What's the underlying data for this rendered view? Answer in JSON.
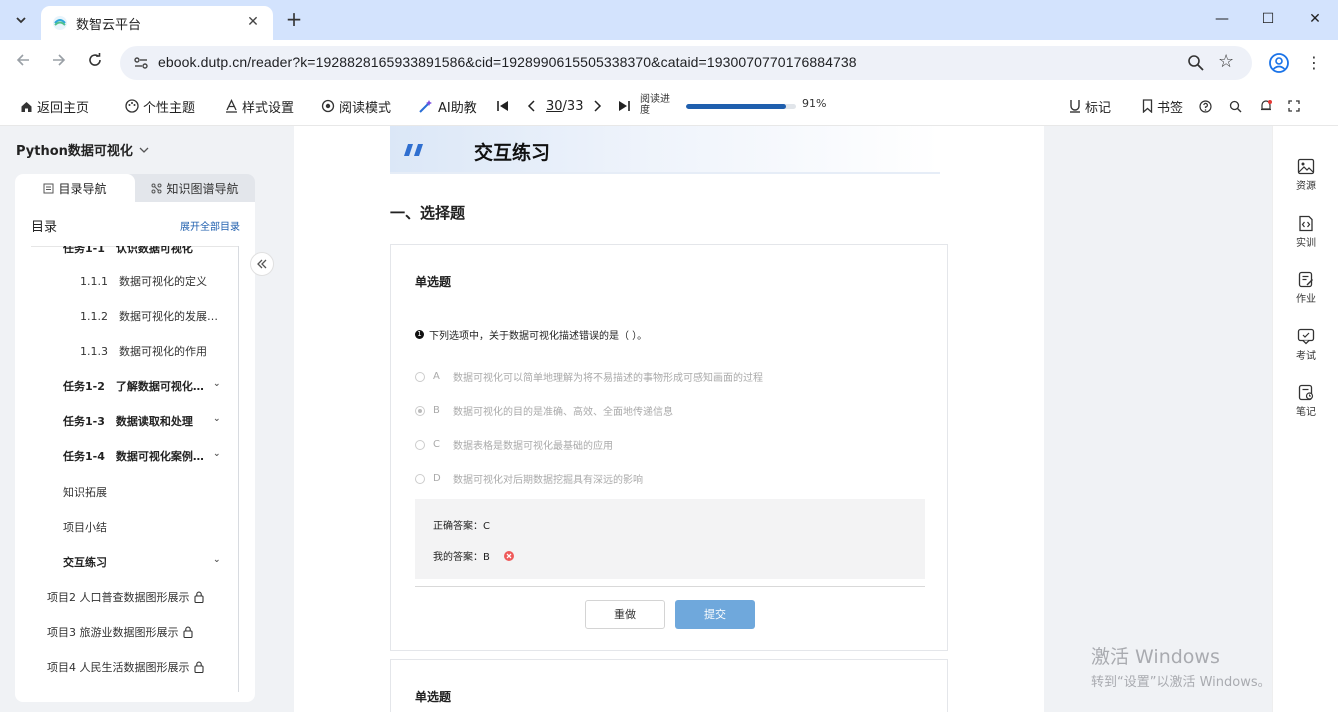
{
  "browser": {
    "tab_title": "数智云平台",
    "tab_close": "✕",
    "new_tab": "+",
    "url": "ebook.dutp.cn/reader?k=1928828165933891586&cid=1928990615505338370&cataid=1930070770176884738",
    "window_controls": {
      "minimize": "—",
      "maximize": "☐",
      "close": "✕"
    }
  },
  "toolbar": {
    "home": "返回主页",
    "theme": "个性主题",
    "style": "样式设置",
    "read_mode": "阅读模式",
    "ai": "AI助教",
    "current_page": "30",
    "total_pages": "/33",
    "progress_label": "阅读进度",
    "progress_percent": "91%",
    "progress_value": 0.91,
    "mark": "标记",
    "bookmark": "书签"
  },
  "sidebar": {
    "book_title": "Python数据可视化",
    "tab_toc": "目录导航",
    "tab_graph": "知识图谱导航",
    "toc_heading": "目录",
    "expand_all": "展开全部目录",
    "items": [
      {
        "label": "任务1-1　认识数据可视化",
        "level": 2
      },
      {
        "label": "1.1.1　数据可视化的定义",
        "level": 3
      },
      {
        "label": "1.1.2　数据可视化的发展…",
        "level": 3
      },
      {
        "label": "1.1.3　数据可视化的作用",
        "level": 3
      },
      {
        "label": "任务1-2　了解数据可视化…",
        "level": 2
      },
      {
        "label": "任务1-3　数据读取和处理",
        "level": 2
      },
      {
        "label": "任务1-4　数据可视化案例…",
        "level": 2
      },
      {
        "label": "知识拓展",
        "level": 2
      },
      {
        "label": "项目小结",
        "level": 2
      },
      {
        "label": "交互练习",
        "level": 2
      },
      {
        "label": "项目2 人口普查数据图形展示",
        "level": 1
      },
      {
        "label": "项目3 旅游业数据图形展示",
        "level": 1
      },
      {
        "label": "项目4 人民生活数据图形展示",
        "level": 1
      }
    ]
  },
  "content": {
    "section_title": "交互练习",
    "part_title": "一、选择题",
    "question1": {
      "type": "单选题",
      "number": "1",
      "stem": "下列选项中，关于数据可视化描述错误的是（ ）。",
      "options": [
        {
          "key": "A",
          "text": "数据可视化可以简单地理解为将不易描述的事物形成可感知画面的过程"
        },
        {
          "key": "B",
          "text": "数据可视化的目的是准确、高效、全面地传递信息"
        },
        {
          "key": "C",
          "text": "数据表格是数据可视化最基础的应用"
        },
        {
          "key": "D",
          "text": "数据可视化对后期数据挖掘具有深远的影响"
        }
      ],
      "selected": "B",
      "correct_answer": "正确答案：C",
      "my_answer": "我的答案：B",
      "reset_label": "重做",
      "submit_label": "提交"
    },
    "question2": {
      "type": "单选题"
    }
  },
  "right_rail": {
    "resources": "资源",
    "training": "实训",
    "homework": "作业",
    "exam": "考试",
    "notes": "笔记"
  },
  "watermark": {
    "line1": "激活 Windows",
    "line2": "转到“设置”以激活 Windows。"
  }
}
